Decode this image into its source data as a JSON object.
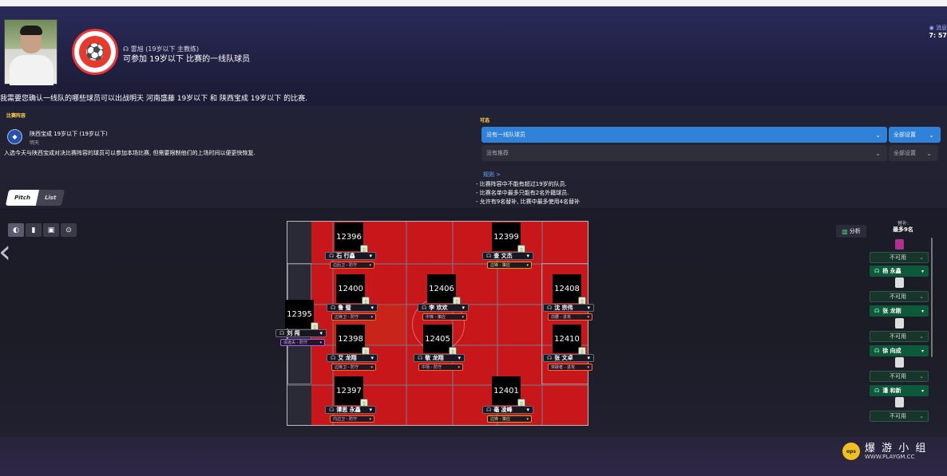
{
  "header": {
    "sender": "☊ 雷旭 (19岁以下 主教练)",
    "message_title": "可参加 19岁以下 比赛的一线队球员",
    "top_right_label": "◉ 消息",
    "time": "7: 57"
  },
  "main_question": "我需要您确认一线队的哪些球员可以出战明天  河南盛藤 19岁以下 和 陕西宝成 19岁以下 的比赛.",
  "left_panel": {
    "section_label": "比赛阵容",
    "team_name": "陕西宝成 19岁以下 (19岁以下)",
    "team_date": "明天",
    "note": "入选今天与陕西宝成对决比赛阵容的球员可以参加本场比赛, 但需要限制他们的上场时间以便更快恢复."
  },
  "right_panel": {
    "section_label": "可选",
    "dropdown1": {
      "value": "没有一线队球员",
      "action": "全部设置"
    },
    "dropdown2": {
      "value": "没有推荐",
      "action": "全部设置"
    },
    "rules_title": "规则  >",
    "rules": [
      "- 比赛阵容中不能有超过19岁的队员.",
      "- 比赛名单中最多只能有2名外籍球员.",
      "- 允许有9名替补, 比赛中最多使用4名替补"
    ]
  },
  "view_toggle": {
    "pitch": "Pitch",
    "list": "List"
  },
  "colors": {
    "accent_blue": "#2f82d8",
    "pitch_red": "#c8171a",
    "sub_green": "#0d5a3a"
  },
  "players": [
    {
      "id": "12395",
      "name": "刘 闯",
      "role": "清道夫 - 防守"
    },
    {
      "id": "12396",
      "name": "石 行鑫",
      "role": "边后卫 - 防守"
    },
    {
      "id": "12399",
      "name": "查 文杰",
      "role": "边锋 - 策应"
    },
    {
      "id": "12400",
      "name": "鲁 璧",
      "role": "边锋卫 - 防守"
    },
    {
      "id": "12406",
      "name": "李 欢欢",
      "role": "中锋 - 策应"
    },
    {
      "id": "12408",
      "name": "沈 宗伟",
      "role": "前腰 - 进攻"
    },
    {
      "id": "12398",
      "name": "艾 龙翔",
      "role": "边锋卫 - 防守"
    },
    {
      "id": "12405",
      "name": "敬 龙翔",
      "role": "中场 - 防守"
    },
    {
      "id": "12410",
      "name": "张 文卓",
      "role": "突破者 - 进攻"
    },
    {
      "id": "12397",
      "name": "谭思 永鑫",
      "role": "内边卫 - 防守"
    },
    {
      "id": "12401",
      "name": "毫 凌峰",
      "role": "边锋 - 策应"
    }
  ],
  "analysis_label": "分析",
  "subs": {
    "title": "替补:",
    "subtitle": "最多9名",
    "unavailable_label": "不可用",
    "names": [
      "杨 永鑫",
      "张 龙刚",
      "徐 向成",
      "潘 和新"
    ]
  },
  "watermark": {
    "cn": "爆 游 小 组",
    "url": "WWW.PLAYGM.CC",
    "logo": "ops"
  }
}
